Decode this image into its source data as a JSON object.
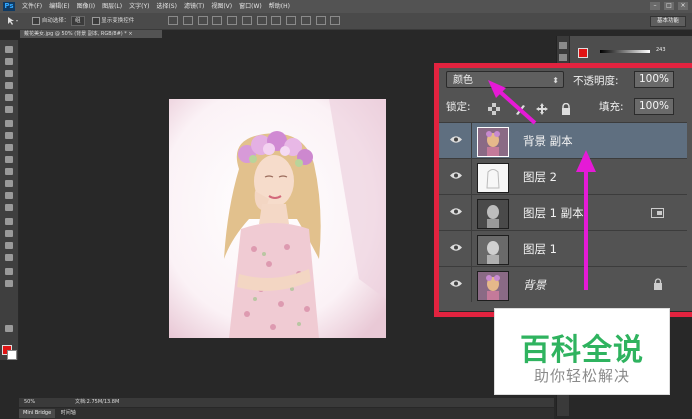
{
  "app": {
    "logo": "Ps",
    "menu": [
      "文件(F)",
      "编辑(E)",
      "图像(I)",
      "图层(L)",
      "文字(Y)",
      "选择(S)",
      "滤镜(T)",
      "视图(V)",
      "窗口(W)",
      "帮助(H)"
    ],
    "window_buttons": [
      "–",
      "□",
      "×"
    ]
  },
  "options_bar": {
    "auto_select_label": "自动选择：",
    "auto_select_value": "组",
    "show_transform_label": "显示变换控件",
    "workspace": "基本功能"
  },
  "document": {
    "tab_title": "戴花美女.jpg @ 50% (背景 副本, RGB/8#) *",
    "tab_close": "×"
  },
  "status_bar": {
    "zoom": "50%",
    "doc_info": "文档:2.75M/13.8M"
  },
  "bottom_tabs": [
    "Mini Bridge",
    "时间轴"
  ],
  "color_panel": {
    "value": "243"
  },
  "layers_panel": {
    "blend_mode": "颜色",
    "opacity_label": "不透明度:",
    "opacity_value": "100%",
    "lock_label": "锁定:",
    "fill_label": "填充:",
    "fill_value": "100%",
    "layers": [
      {
        "name": "背景 副本",
        "selected": true,
        "italic": false,
        "badge": ""
      },
      {
        "name": "图层 2",
        "selected": false,
        "italic": false,
        "badge": ""
      },
      {
        "name": "图层 1 副本",
        "selected": false,
        "italic": false,
        "badge": "smart-object-icon"
      },
      {
        "name": "图层 1",
        "selected": false,
        "italic": false,
        "badge": ""
      },
      {
        "name": "背景",
        "selected": false,
        "italic": true,
        "badge": "lock-icon"
      }
    ]
  },
  "watermark": {
    "title": "百科全说",
    "subtitle": "助你轻松解决"
  },
  "colors": {
    "highlight_frame": "#e2233f",
    "annotation_arrow": "#e51ad6",
    "watermark_green": "#2fb35f"
  }
}
